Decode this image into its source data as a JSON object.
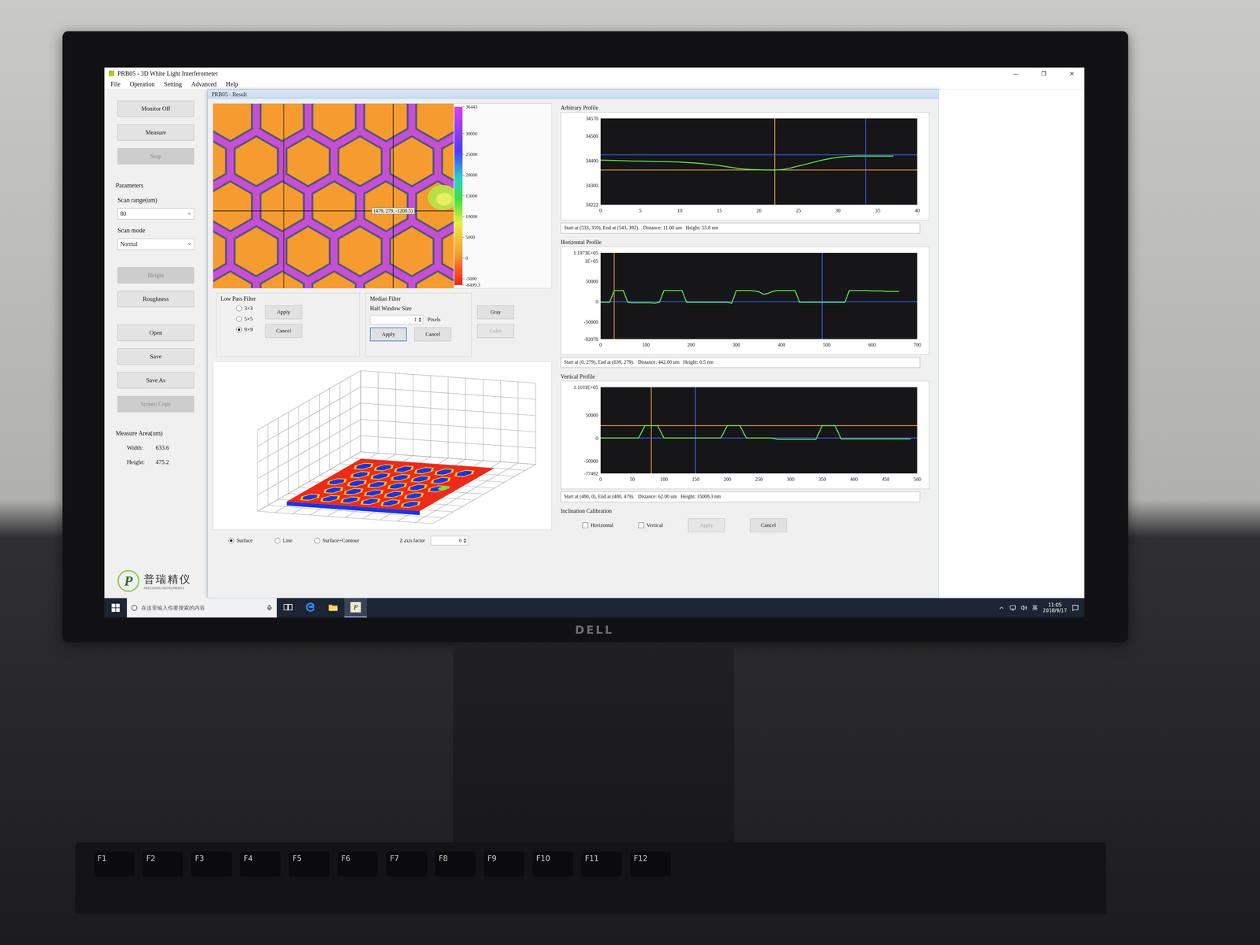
{
  "window": {
    "title": "PRB05 - 3D White Light Interferometer",
    "controls": [
      "—",
      "❐",
      "✕"
    ]
  },
  "menu": [
    "File",
    "Operation",
    "Setting",
    "Advanced",
    "Help"
  ],
  "sidebar": {
    "groups": [
      [
        {
          "kind": "button",
          "label": "Monitor Off",
          "disabled": false
        },
        {
          "kind": "button",
          "label": "Measure",
          "disabled": false
        },
        {
          "kind": "button",
          "label": "Stop",
          "disabled": true
        }
      ],
      [
        {
          "kind": "heading",
          "label": "Parameters"
        },
        {
          "kind": "select",
          "label": "Scan range(um)",
          "value": "80"
        },
        {
          "kind": "select",
          "label": "Scan mode",
          "value": "Normal"
        }
      ],
      [
        {
          "kind": "button",
          "label": "Height",
          "disabled": true
        },
        {
          "kind": "button",
          "label": "Roughness",
          "disabled": false
        }
      ],
      [
        {
          "kind": "button",
          "label": "Open",
          "disabled": false
        },
        {
          "kind": "button",
          "label": "Save",
          "disabled": false
        },
        {
          "kind": "button",
          "label": "Save As",
          "disabled": false
        },
        {
          "kind": "button",
          "label": "Screen Copy",
          "disabled": true
        }
      ],
      [
        {
          "kind": "heading",
          "label": "Measure Area(um)"
        },
        {
          "kind": "field",
          "label": "Width:",
          "value": "633.6"
        },
        {
          "kind": "field",
          "label": "Height:",
          "value": "475.2"
        }
      ]
    ],
    "logo": {
      "mark": "P",
      "name": "普瑞精仪",
      "subtitle": "PRECISION INSTRUMENTS"
    }
  },
  "result": {
    "title": "PRB05 - Result",
    "map": {
      "image_width": 640,
      "image_height": 480,
      "guides_x": [
        188,
        479
      ],
      "guides_y": [
        279
      ],
      "cursor_x": 479,
      "cursor_y": 279,
      "tooltip": "(479, 279, -1200.5)",
      "colorbar": {
        "min": -6499.3,
        "max": 36443,
        "ticks": [
          {
            "value": 36443,
            "label": "36443"
          },
          {
            "value": 30000,
            "label": "30000"
          },
          {
            "value": 25000,
            "label": "25000"
          },
          {
            "value": 20000,
            "label": "20000"
          },
          {
            "value": 15000,
            "label": "15000"
          },
          {
            "value": 10000,
            "label": "10000"
          },
          {
            "value": 5000,
            "label": "5000"
          },
          {
            "value": 0,
            "label": "0"
          },
          {
            "value": -5000,
            "label": "-5000"
          },
          {
            "value": -6499.3,
            "label": "-6499.3"
          }
        ]
      }
    },
    "low_pass": {
      "title": "Low Pass Filter",
      "options": [
        {
          "label": "3×3",
          "selected": false
        },
        {
          "label": "5×5",
          "selected": false
        },
        {
          "label": "9×9",
          "selected": true
        }
      ],
      "buttons": [
        "Apply",
        "Cancel"
      ]
    },
    "median": {
      "title": "Median Filter",
      "size_label": "Half Window Size",
      "size": "1",
      "unit": "Pixels",
      "buttons": [
        {
          "label": "Apply",
          "focused": true
        },
        {
          "label": "Cancel",
          "focused": false
        }
      ]
    },
    "view_buttons": [
      {
        "label": "Gray",
        "disabled": false
      },
      {
        "label": "Color",
        "disabled": true
      }
    ],
    "display_modes": [
      {
        "label": "Surface",
        "selected": true
      },
      {
        "label": "Line",
        "selected": false
      },
      {
        "label": "Surface+Contour",
        "selected": false
      }
    ],
    "z_factor": {
      "label": "Z axis factor",
      "value": "6"
    },
    "profiles": [
      {
        "title": "Arbitrary Profile",
        "y_min": 34222,
        "y_max": 34570,
        "y_ticks": [
          {
            "value": 34570,
            "label": "34570"
          },
          {
            "value": 34500,
            "label": "34500"
          },
          {
            "value": 34400,
            "label": "34400"
          },
          {
            "value": 34300,
            "label": "34300"
          },
          {
            "value": 34222,
            "label": "34222"
          }
        ],
        "x_min": 0,
        "x_max": 40,
        "x_ticks": [
          "0",
          "5",
          "10",
          "15",
          "20",
          "25",
          "30",
          "35",
          "40"
        ],
        "x_step": 1,
        "values": [
          34402,
          34401,
          34400,
          34399,
          34398,
          34398,
          34397,
          34396,
          34396,
          34395,
          34394,
          34392,
          34390,
          34387,
          34384,
          34380,
          34375,
          34370,
          34366,
          34364,
          34363,
          34362,
          34362,
          34364,
          34370,
          34378,
          34386,
          34394,
          34402,
          34408,
          34413,
          34416,
          34418,
          34418,
          34418,
          34418,
          34418,
          34418
        ],
        "markers": [
          {
            "axis": "x",
            "value": 22,
            "color": "#f0a030"
          },
          {
            "axis": "x",
            "value": 33.5,
            "color": "#3a5cff"
          },
          {
            "axis": "y",
            "value": 34362,
            "color": "#f0a030"
          },
          {
            "axis": "y",
            "value": 34423,
            "color": "#3a5cff"
          }
        ],
        "info": "Start at (533, 359), End at (543, 392).   Distance: 11.00 um   Height: 55.8 nm"
      },
      {
        "title": "Horizontal Profile",
        "y_min": -92078,
        "y_max": 119730,
        "y_ticks": [
          {
            "value": 119730,
            "label": "1.1973E+05"
          },
          {
            "value": 100000,
            "label": "1E+05"
          },
          {
            "value": 50000,
            "label": "50000"
          },
          {
            "value": 0,
            "label": "0"
          },
          {
            "value": -50000,
            "label": "-50000"
          },
          {
            "value": -92078,
            "label": "-92078"
          }
        ],
        "x_min": 0,
        "x_max": 700,
        "x_ticks": [
          "0",
          "100",
          "200",
          "300",
          "400",
          "500",
          "600",
          "700"
        ],
        "x_step": 10,
        "values": [
          -2000,
          -2000,
          -2000,
          27000,
          27000,
          27000,
          -2000,
          -3000,
          -3000,
          -3000,
          -3000,
          -3000,
          -4000,
          -2000,
          27000,
          27000,
          27000,
          27000,
          27000,
          -2000,
          -2000,
          -2000,
          -2000,
          -2000,
          -2000,
          -2000,
          -2000,
          -2000,
          -2000,
          -4000,
          27000,
          27000,
          27000,
          27000,
          26000,
          24000,
          18000,
          20000,
          25000,
          27000,
          27000,
          27000,
          27000,
          27000,
          -2000,
          -2000,
          -2000,
          -2000,
          -2000,
          -2000,
          -2000,
          -2000,
          -2000,
          -2000,
          -2000,
          27000,
          27000,
          27000,
          27000,
          27000,
          26000,
          26000,
          26000,
          25000,
          25000,
          25000,
          25000
        ],
        "markers": [
          {
            "axis": "x",
            "value": 30,
            "color": "#f0a030"
          },
          {
            "axis": "x",
            "value": 490,
            "color": "#3a5cff"
          },
          {
            "axis": "y",
            "value": 0,
            "color": "#3a5cff"
          }
        ],
        "info": "Start at (0, 279), End at (639, 279).   Distance: 442.00 um   Height: 0.5 nm"
      },
      {
        "title": "Vertical Profile",
        "y_min": -77492,
        "y_max": 111010,
        "y_ticks": [
          {
            "value": 111010,
            "label": "1.1101E+05"
          },
          {
            "value": 50000,
            "label": "50000"
          },
          {
            "value": 0,
            "label": "0"
          },
          {
            "value": -50000,
            "label": "-50000"
          },
          {
            "value": -77492,
            "label": "-77492"
          }
        ],
        "x_min": 0,
        "x_max": 500,
        "x_ticks": [
          "0",
          "50",
          "100",
          "150",
          "200",
          "250",
          "300",
          "350",
          "400",
          "450",
          "500"
        ],
        "x_step": 10,
        "values": [
          0,
          0,
          0,
          0,
          0,
          0,
          0,
          27000,
          27000,
          27000,
          0,
          0,
          0,
          0,
          0,
          0,
          0,
          0,
          0,
          0,
          27000,
          27000,
          27000,
          0,
          0,
          0,
          0,
          0,
          -3000,
          -3000,
          -3000,
          -3000,
          -3000,
          -3000,
          -3000,
          27000,
          27000,
          27000,
          -2000,
          -2000,
          -2000,
          -2000,
          -2000,
          -2000,
          -2000,
          -2000,
          -2000,
          -2000,
          -2000,
          -2000
        ],
        "markers": [
          {
            "axis": "x",
            "value": 80,
            "color": "#f0a030"
          },
          {
            "axis": "x",
            "value": 150,
            "color": "#3a5cff"
          },
          {
            "axis": "y",
            "value": 27000,
            "color": "#f0a030"
          },
          {
            "axis": "y",
            "value": 0,
            "color": "#3a5cff"
          }
        ],
        "info": "Start at (480, 0), End at (480, 479).   Distance: 62.00 um   Height: 35008.3 nm"
      }
    ],
    "inclination": {
      "title": "Inclination Calibration",
      "options": [
        {
          "label": "Horizontal",
          "checked": false
        },
        {
          "label": "Vertical",
          "checked": false
        }
      ],
      "buttons": [
        {
          "label": "Apply",
          "disabled": true
        },
        {
          "label": "Cancel",
          "disabled": false
        }
      ]
    }
  },
  "taskbar": {
    "search_placeholder": "在这里输入你要搜索的内容",
    "apps": [
      {
        "kind": "task-view",
        "label": "",
        "selected": false
      },
      {
        "kind": "edge",
        "label": "",
        "selected": false
      },
      {
        "kind": "explorer",
        "label": "",
        "selected": false
      },
      {
        "kind": "app",
        "label": "P",
        "selected": true
      }
    ],
    "ime": "英",
    "time": "11:05",
    "date": "2018/9/17"
  },
  "monitor": {
    "brand": "DELL"
  },
  "keyboard": {
    "keys": [
      "F1",
      "F2",
      "F3",
      "F4",
      "F5",
      "F6",
      "F7",
      "F8",
      "F9",
      "F10",
      "F11",
      "F12"
    ]
  }
}
